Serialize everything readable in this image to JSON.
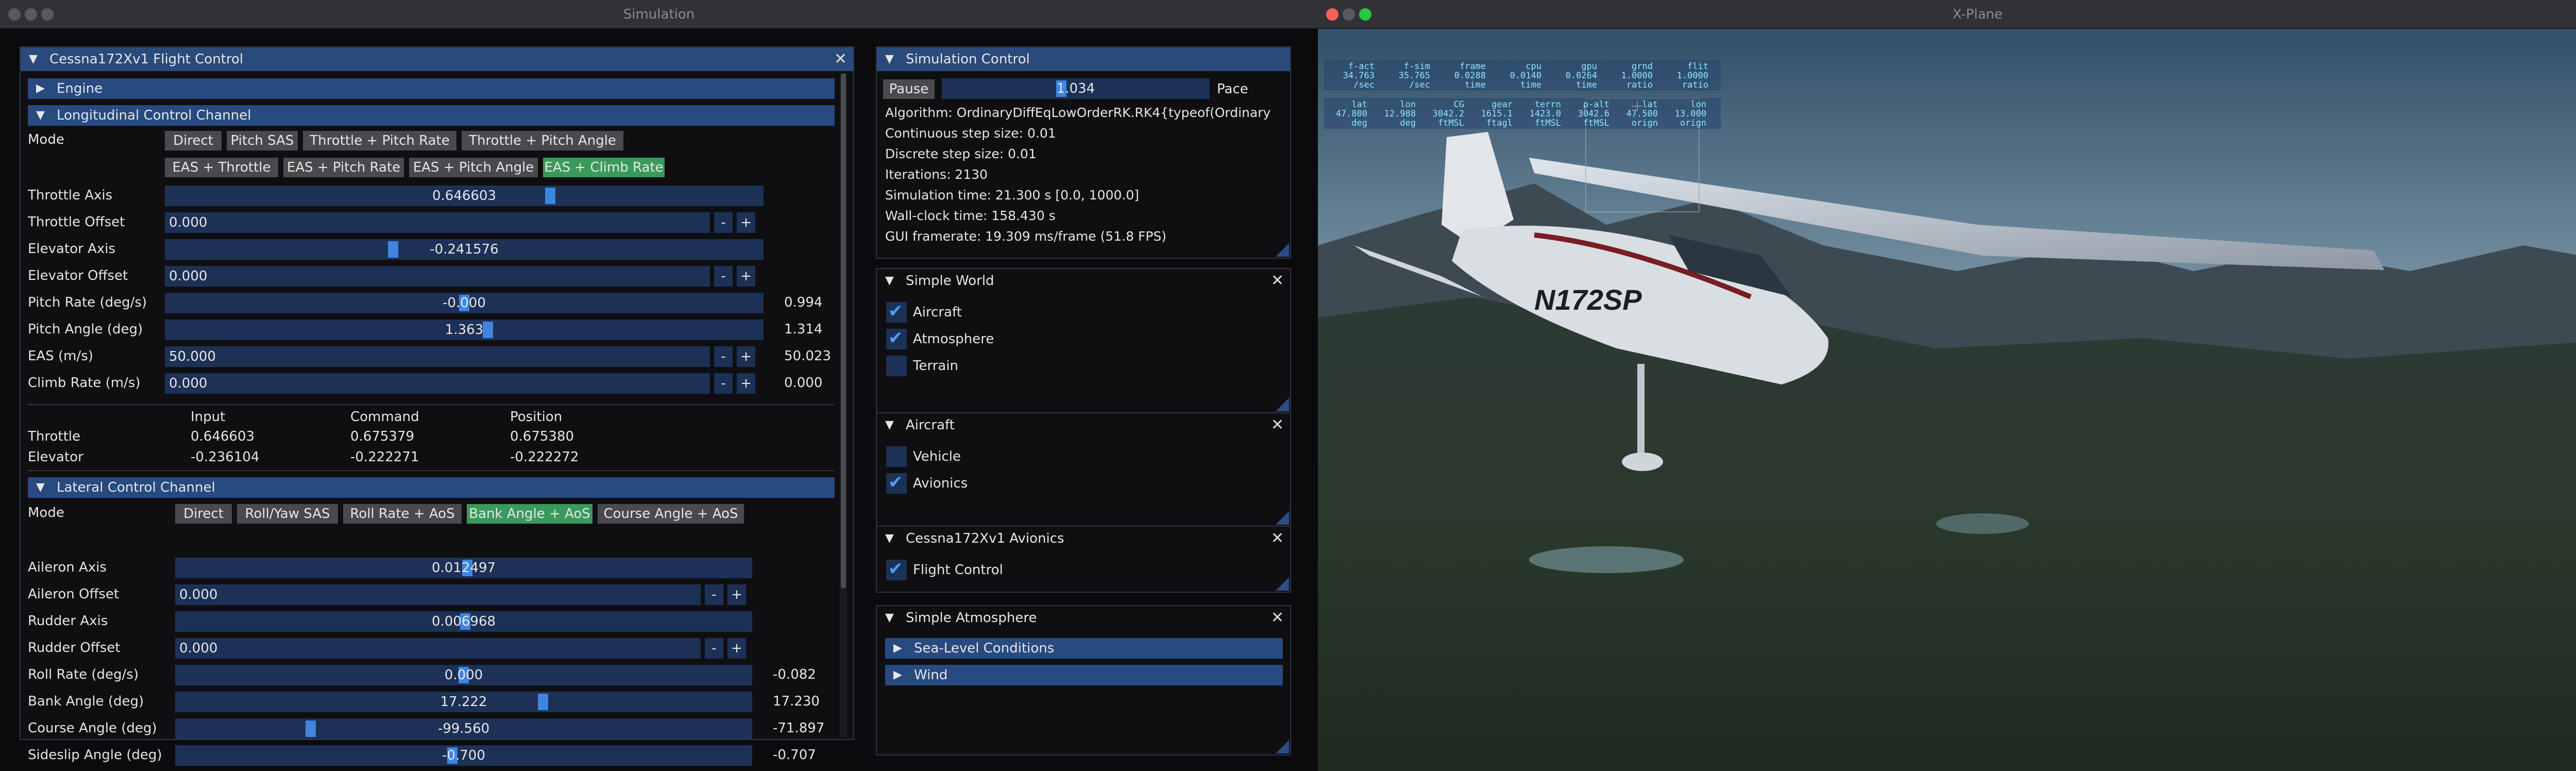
{
  "sim_window": {
    "title": "Simulation",
    "flight_control": {
      "title": "Cessna172Xv1 Flight Control",
      "engine_header": "Engine",
      "long_header": "Longitudinal Control Channel",
      "mode_label": "Mode",
      "long_modes": [
        "Direct",
        "Pitch SAS",
        "Throttle + Pitch Rate",
        "Throttle + Pitch Angle",
        "EAS + Throttle",
        "EAS + Pitch Rate",
        "EAS + Pitch Angle",
        "EAS + Climb Rate"
      ],
      "long_rows": [
        {
          "label": "Throttle Axis",
          "value": "0.646603",
          "readout": "",
          "fraction": 0.646
        },
        {
          "label": "Throttle Offset",
          "value": "0.000",
          "readout": ""
        },
        {
          "label": "Elevator Axis",
          "value": "-0.241576",
          "readout": "",
          "fraction": 0.379
        },
        {
          "label": "Elevator Offset",
          "value": "0.000",
          "readout": ""
        },
        {
          "label": "Pitch Rate (deg/s)",
          "value": "-0.000",
          "readout": "0.994",
          "fraction": 0.5
        },
        {
          "label": "Pitch Angle (deg)",
          "value": "1.363",
          "readout": "1.314",
          "fraction": 0.54
        },
        {
          "label": "EAS (m/s)",
          "value": "50.000",
          "readout": "50.023"
        },
        {
          "label": "Climb Rate (m/s)",
          "value": "0.000",
          "readout": "0.000"
        }
      ],
      "table_headers": [
        "Input",
        "Command",
        "Position"
      ],
      "table_rows": [
        {
          "name": "Throttle",
          "input": "0.646603",
          "command": "0.675379",
          "position": "0.675380"
        },
        {
          "name": "Elevator",
          "input": "-0.236104",
          "command": "-0.222271",
          "position": "-0.222272"
        }
      ],
      "lat_header": "Lateral Control Channel",
      "lat_modes": [
        "Direct",
        "Roll/Yaw SAS",
        "Roll Rate + AoS",
        "Bank Angle + AoS",
        "Course Angle + AoS"
      ],
      "lat_rows": [
        {
          "label": "Aileron Axis",
          "value": "0.012497",
          "readout": "",
          "fraction": 0.506
        },
        {
          "label": "Aileron Offset",
          "value": "0.000",
          "readout": ""
        },
        {
          "label": "Rudder Axis",
          "value": "0.006968",
          "readout": "",
          "fraction": 0.503
        },
        {
          "label": "Rudder Offset",
          "value": "0.000",
          "readout": ""
        },
        {
          "label": "Roll Rate (deg/s)",
          "value": "0.000",
          "readout": "-0.082",
          "fraction": 0.5
        },
        {
          "label": "Bank Angle (deg)",
          "value": "17.222",
          "readout": "17.230",
          "fraction": 0.64
        },
        {
          "label": "Course Angle (deg)",
          "value": "-99.560",
          "readout": "-71.897",
          "fraction": 0.23
        },
        {
          "label": "Sideslip Angle (deg)",
          "value": "-0.700",
          "readout": "-0.707",
          "fraction": 0.48
        }
      ],
      "plus": "+",
      "minus": "-"
    },
    "sim_control": {
      "title": "Simulation Control",
      "pause": "Pause",
      "pace_value": "1.034",
      "pace_label": "Pace",
      "lines": [
        "Algorithm: OrdinaryDiffEqLowOrderRK.RK4{typeof(Ordinary",
        "Continuous step size: 0.01",
        "Discrete step size: 0.01",
        "Iterations: 2130",
        "Simulation time: 21.300 s [0.0, 1000.0]",
        "Wall-clock time: 158.430 s",
        "GUI framerate: 19.309 ms/frame (51.8 FPS)"
      ]
    },
    "simple_world": {
      "title": "Simple World",
      "items": [
        {
          "label": "Aircraft",
          "checked": true
        },
        {
          "label": "Atmosphere",
          "checked": true
        },
        {
          "label": "Terrain",
          "checked": false
        }
      ]
    },
    "aircraft": {
      "title": "Aircraft",
      "items": [
        {
          "label": "Vehicle",
          "checked": false
        },
        {
          "label": "Avionics",
          "checked": true
        }
      ]
    },
    "avionics": {
      "title": "Cessna172Xv1 Avionics",
      "items": [
        {
          "label": "Flight Control",
          "checked": true
        }
      ]
    },
    "atmosphere": {
      "title": "Simple Atmosphere",
      "headers": [
        "Sea-Level Conditions",
        "Wind"
      ]
    },
    "close": "✕"
  },
  "xplane_window": {
    "title": "X-Plane",
    "registration": "N172SP",
    "overlay1": {
      "cols": [
        {
          "h": "f-act",
          "v": "34.763",
          "u": "/sec"
        },
        {
          "h": "f-sim",
          "v": "35.765",
          "u": "/sec"
        },
        {
          "h": "frame",
          "v": "0.0288",
          "u": "time"
        },
        {
          "h": "cpu",
          "v": "0.0140",
          "u": "time"
        },
        {
          "h": "gpu",
          "v": "0.0264",
          "u": "time"
        },
        {
          "h": "grnd",
          "v": "1.0000",
          "u": "ratio"
        },
        {
          "h": "flit",
          "v": "1.0000",
          "u": "ratio"
        }
      ]
    },
    "overlay2": {
      "cols": [
        {
          "h": "lat",
          "v": "47.800",
          "u": "deg"
        },
        {
          "h": "lon",
          "v": "12.988",
          "u": "deg"
        },
        {
          "h": "CG",
          "v": "3042.2",
          "u": "ftMSL"
        },
        {
          "h": "gear",
          "v": "1615.1",
          "u": "ftagl"
        },
        {
          "h": "terrn",
          "v": "1423.0",
          "u": "ftMSL"
        },
        {
          "h": "p-alt",
          "v": "3042.6",
          "u": "ftMSL"
        },
        {
          "h": "lat",
          "v": "47.500",
          "u": "orign"
        },
        {
          "h": "lon",
          "v": "13.000",
          "u": "orign"
        }
      ]
    }
  },
  "colors": {
    "accent": "#3d85e0",
    "header": "#274a80",
    "active_button": "#3a9a5c",
    "frame_bg": "#1d3157"
  }
}
